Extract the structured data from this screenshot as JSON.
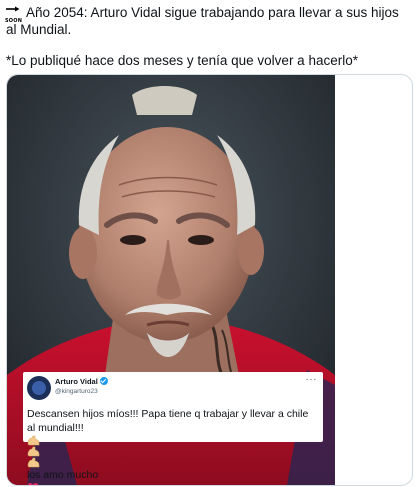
{
  "tweet": {
    "emoji_label": "SOON",
    "paragraph1": "Año 2054: Arturo Vidal sigue trabajando para llevar a sus hijos al Mundial.",
    "paragraph2": "*Lo publiqué hace dos meses y tenía que volver a hacerlo*"
  },
  "embedded_tweet": {
    "display_name": "Arturo Vidal",
    "handle": "@kingarturo23",
    "more_label": "···",
    "body_main": "Descansen hijos míos!!! Papa tiene q trabajar y llevar a chile al mundial!!!",
    "body_tail": " los amo mucho",
    "emojis": [
      "flexed-biceps",
      "flexed-biceps",
      "flexed-biceps",
      "red-heart",
      "red-heart"
    ]
  },
  "colors": {
    "verified_blue": "#1d9bf0",
    "jersey_red": "#c8102e",
    "heart_red": "#e0245e"
  }
}
